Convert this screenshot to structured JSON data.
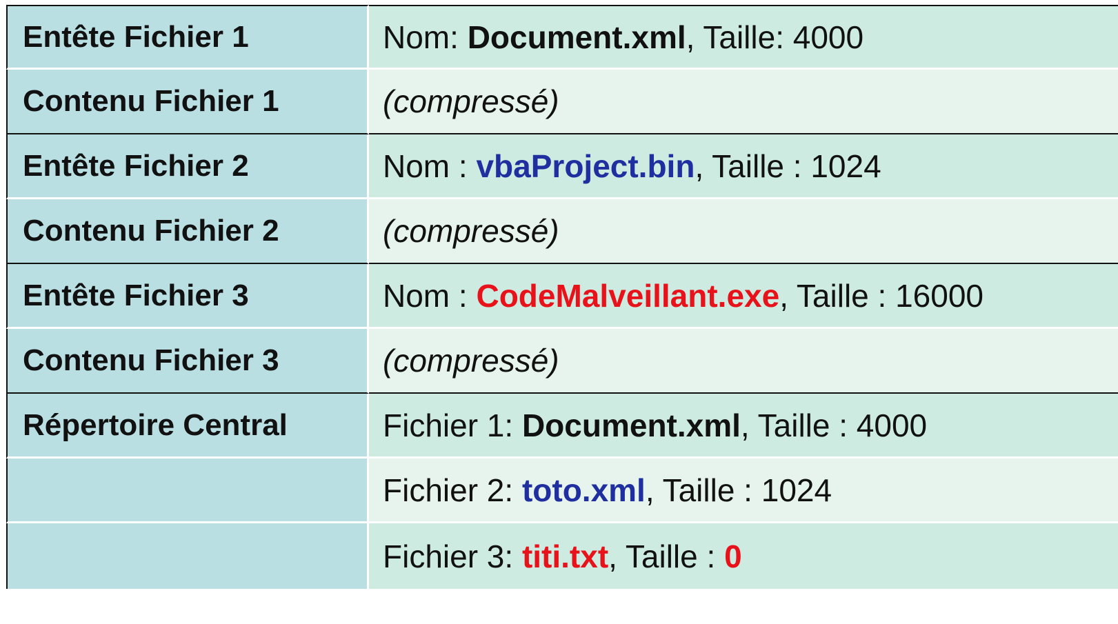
{
  "rows": [
    {
      "label": "Entête Fichier 1",
      "prefix": "Nom: ",
      "name": "Document.xml",
      "suffix": ", Taille: 4000"
    },
    {
      "label": "Contenu Fichier 1",
      "value": "(compressé)"
    },
    {
      "label": "Entête Fichier 2",
      "prefix": "Nom : ",
      "name": "vbaProject.bin",
      "suffix": ", Taille : 1024"
    },
    {
      "label": "Contenu Fichier 2",
      "value": "(compressé)"
    },
    {
      "label": "Entête Fichier 3",
      "prefix": "Nom : ",
      "name": "CodeMalveillant.exe",
      "suffix": ", Taille : 16000"
    },
    {
      "label": "Contenu Fichier 3",
      "value": "(compressé)"
    },
    {
      "label": "Répertoire Central",
      "prefix": "Fichier 1: ",
      "name": "Document.xml",
      "suffix": ", Taille : 4000"
    },
    {
      "label": "",
      "prefix": "Fichier 2: ",
      "name": "toto.xml",
      "suffix": ", Taille : 1024"
    },
    {
      "label": "",
      "prefix": "Fichier 3: ",
      "name": "titi.txt",
      "suffix": ", Taille : ",
      "size": "0"
    }
  ],
  "colors": {
    "label_bg": "#b9dfe3",
    "value_bg_dark": "#cdebe0",
    "value_bg_light": "#e6f4ed",
    "name_blue": "#1f2fa0",
    "name_red": "#e8121a",
    "border": "#111111"
  }
}
